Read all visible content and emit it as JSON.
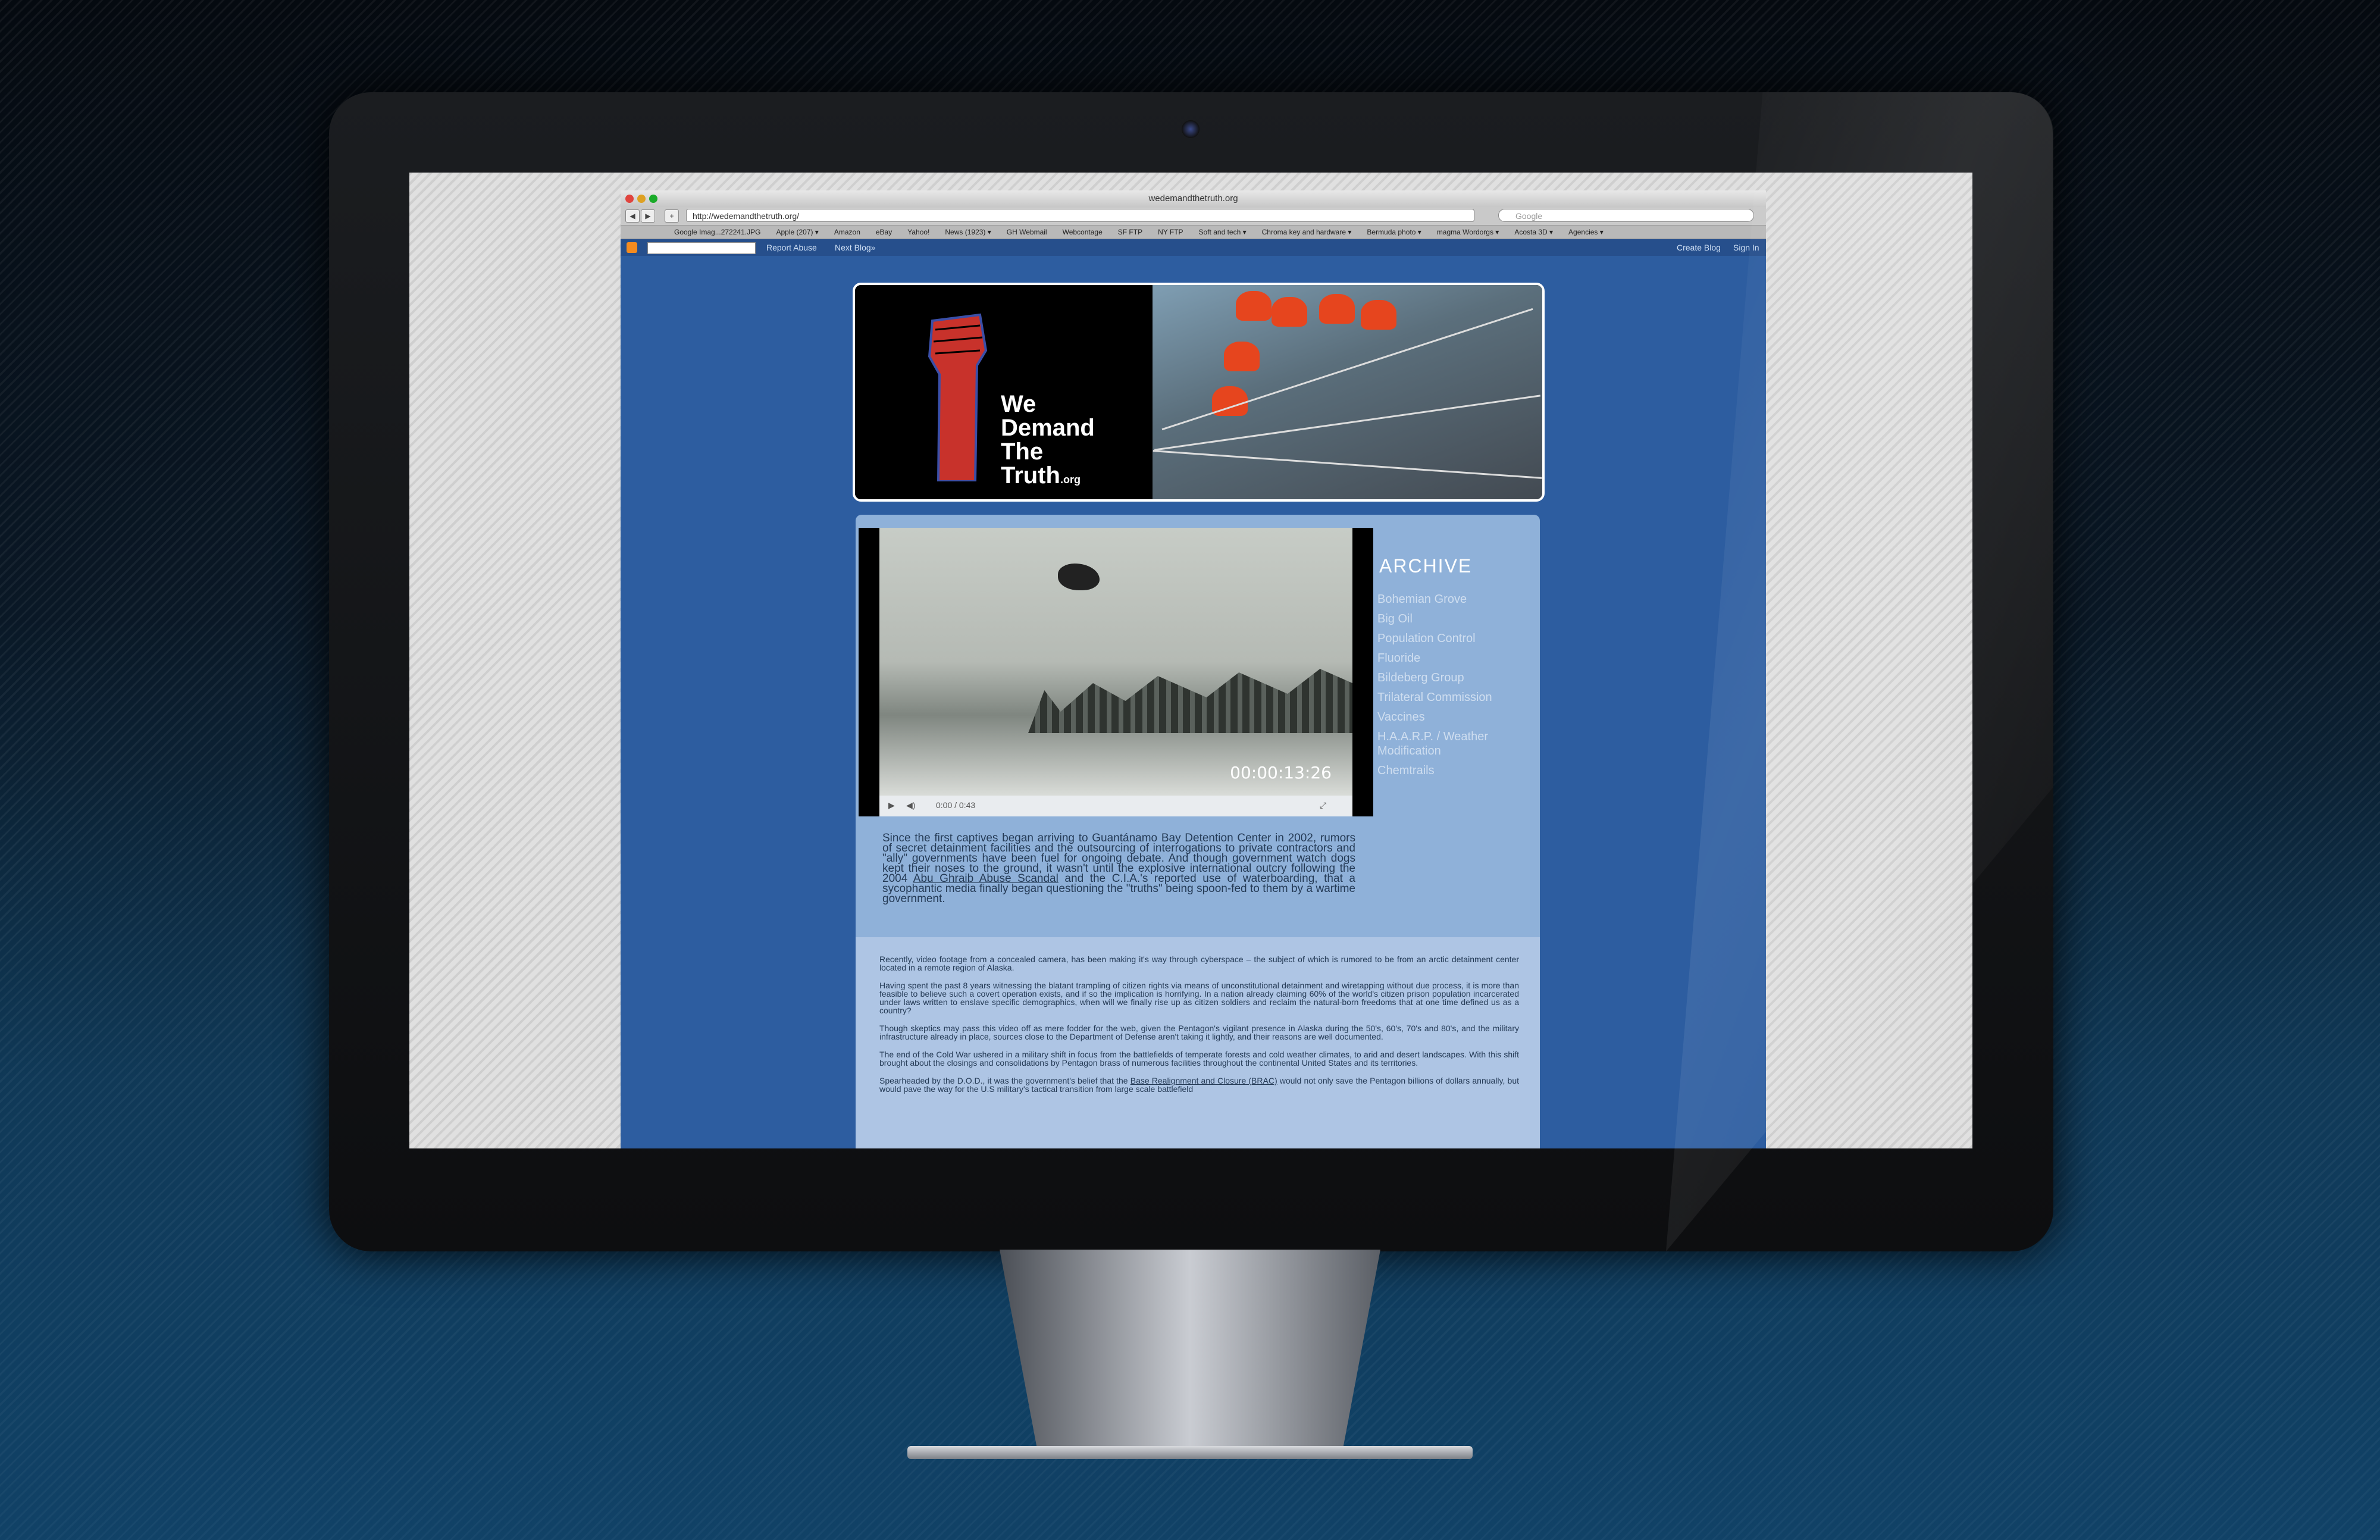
{
  "browser": {
    "window_title": "wedemandthetruth.org",
    "url": "http://wedemandthetruth.org/",
    "search_placeholder": "Google",
    "bookmarks": [
      "Google Imag...272241.JPG",
      "Apple (207) ▾",
      "Amazon",
      "eBay",
      "Yahoo!",
      "News (1923) ▾",
      "GH Webmail",
      "Webcontage",
      "SF FTP",
      "NY FTP",
      "Soft and tech ▾",
      "Chroma key and hardware ▾",
      "Bermuda photo ▾",
      "magma Wordorgs ▾",
      "Acosta 3D ▾",
      "Agencies ▾"
    ]
  },
  "blogger_bar": {
    "report_abuse": "Report Abuse",
    "next_blog": "Next Blog»",
    "create_blog": "Create Blog",
    "sign_in": "Sign In"
  },
  "header": {
    "logo_lines": [
      "We",
      "Demand",
      "The",
      "Truth"
    ],
    "logo_suffix": ".org"
  },
  "video": {
    "timecode": "00:00:13:26",
    "progress_text": "0:00 / 0:43"
  },
  "archive": {
    "title": "ARCHIVE",
    "items": [
      "Bohemian Grove",
      "Big Oil",
      "Population Control",
      "Fluoride",
      "Bildeberg Group",
      "Trilateral Commission",
      "Vaccines",
      "H.A.A.R.P. / Weather Modification",
      "Chemtrails"
    ]
  },
  "intro": {
    "text_before": "Since the first captives began arriving to Guantánamo Bay Detention Center in 2002, rumors of secret detainment facilities and the outsourcing of interrogations to private contractors and \"ally\" governments have been fuel for ongoing debate. And though government watch dogs kept their noses to the ground, it wasn't until the explosive international outcry following the 2004 ",
    "link": "Abu Ghraib Abuse Scandal",
    "text_after": " and the C.I.A.'s reported use of waterboarding, that a sycophantic media finally began questioning the \"truths\" being spoon-fed to them by a wartime government."
  },
  "body": {
    "p1": "Recently, video footage from a concealed camera, has been making it's way through cyberspace – the subject of which is rumored to be from an arctic detainment center located in a remote region of Alaska.",
    "p2": "Having spent the past 8 years witnessing the blatant trampling of citizen rights via means of unconstitutional detainment and wiretapping without due process, it is more than feasible to believe such a covert operation exists, and if so the implication is horrifying. In a nation already claiming 60% of the world's citizen prison population incarcerated under laws written to enslave specific demographics, when will we finally rise up as citizen soldiers and reclaim the natural-born freedoms that at one time defined us as a country?",
    "p3": "Though skeptics may pass this video off as mere fodder for the web, given the Pentagon's vigilant presence in Alaska during the 50's, 60's, 70's and 80's, and the military infrastructure already in place, sources close to the Department of Defense aren't taking it lightly, and their reasons are well documented.",
    "p4": "The end of the Cold War ushered in a military shift in focus from the battlefields of temperate forests and cold weather climates, to arid and desert landscapes. With this shift brought about the closings and consolidations by Pentagon brass of numerous facilities throughout the continental United States and its territories.",
    "p5_before": "Spearheaded by the D.O.D., it was the government's belief that the ",
    "p5_link": "Base Realignment and Closure (BRAC)",
    "p5_after": " would not only save the Pentagon billions of dollars annually, but would pave the way for the U.S military's tactical transition from large scale battlefield"
  },
  "colors": {
    "page_blue": "#2d5da0",
    "content_blue": "#8fb1d9",
    "logo_red": "#c8322b",
    "jumpsuit_orange": "#e6451e"
  }
}
